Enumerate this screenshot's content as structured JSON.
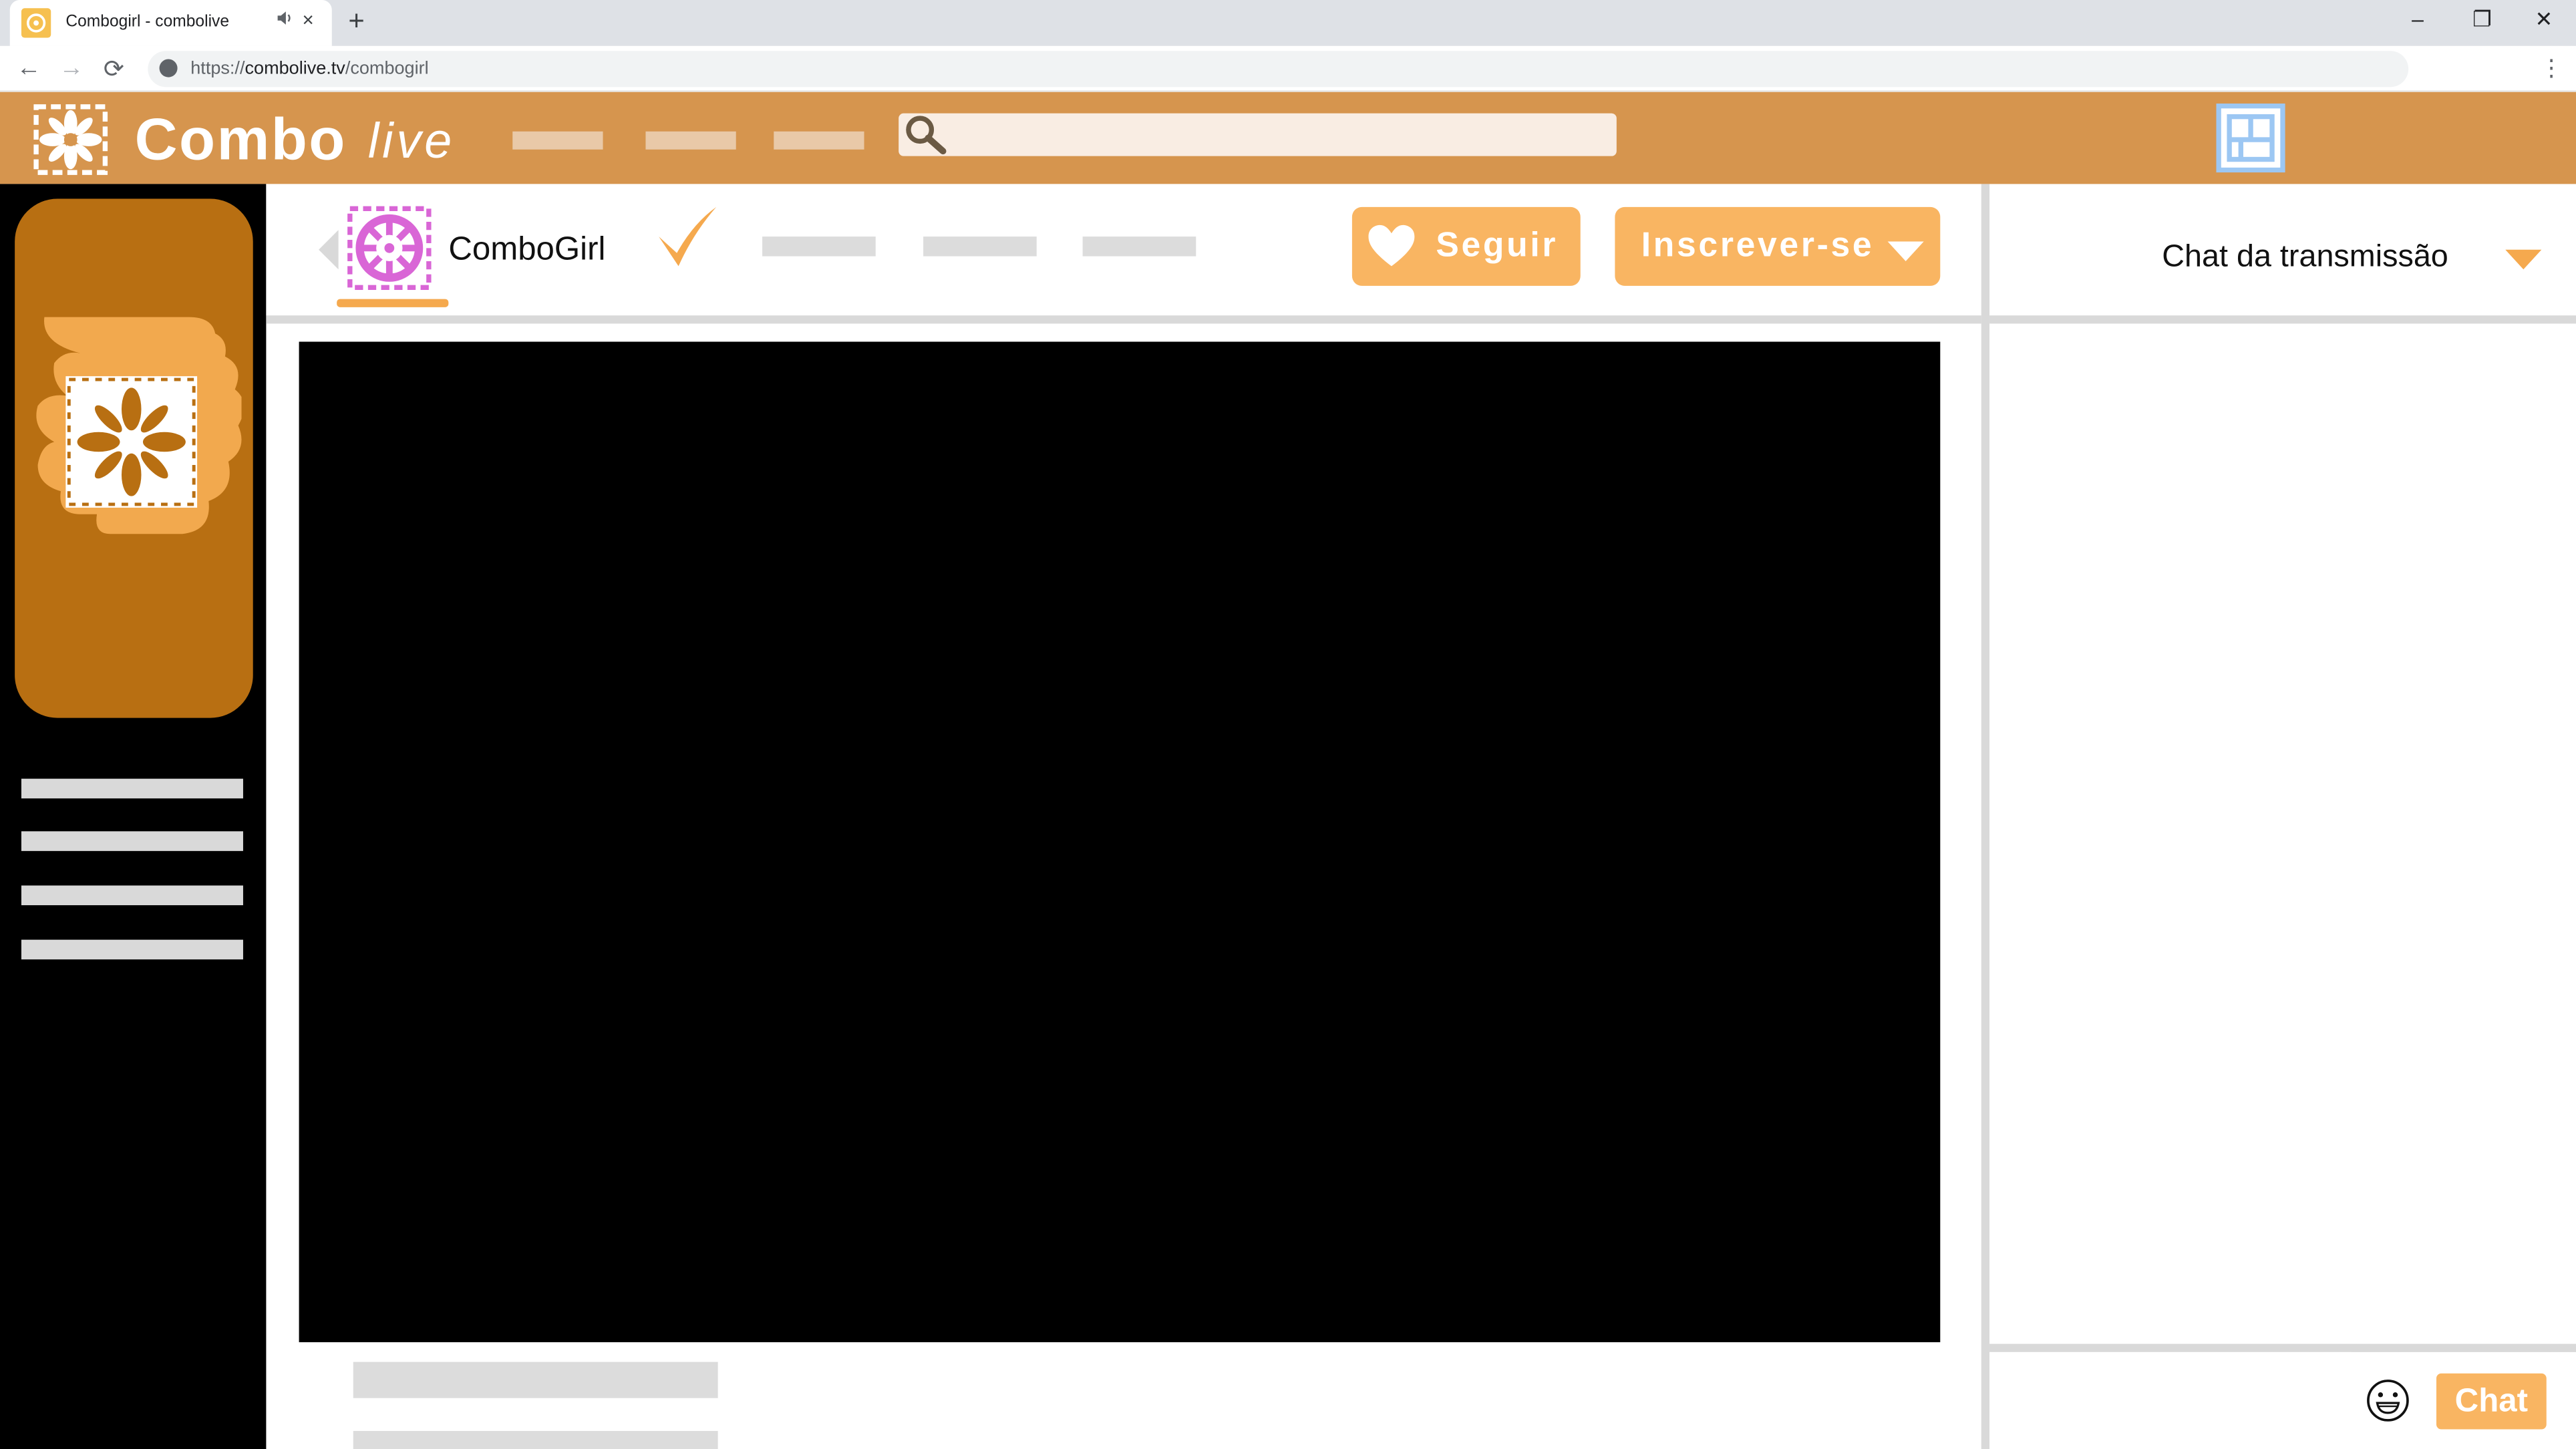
{
  "browser": {
    "tab_title": "Combogirl - combolive",
    "tab_audio_icon": "speaker-icon",
    "tab_close": "×",
    "new_tab": "+",
    "url_prefix": "https://",
    "url_host": "combolive.tv",
    "url_path": "/combogirl",
    "window_minimize": "–",
    "window_restore": "❐",
    "window_close": "✕",
    "back": "←",
    "forward": "→",
    "reload": "⟳",
    "menu": "⋮"
  },
  "site": {
    "logo_combo": "Combo",
    "logo_live": "live",
    "search_placeholder": ""
  },
  "channel": {
    "name": "ComboGirl",
    "follow_label": "Seguir",
    "subscribe_label": "Inscrever-se"
  },
  "chat": {
    "title": "Chat da transmissão",
    "send_label": "Chat",
    "input_placeholder": ""
  },
  "colors": {
    "header": "#d6954e",
    "accent": "#f9b562",
    "sidebar_card": "#b86f12",
    "avatar": "#d966d6",
    "user_icon": "#9cc7f3"
  }
}
